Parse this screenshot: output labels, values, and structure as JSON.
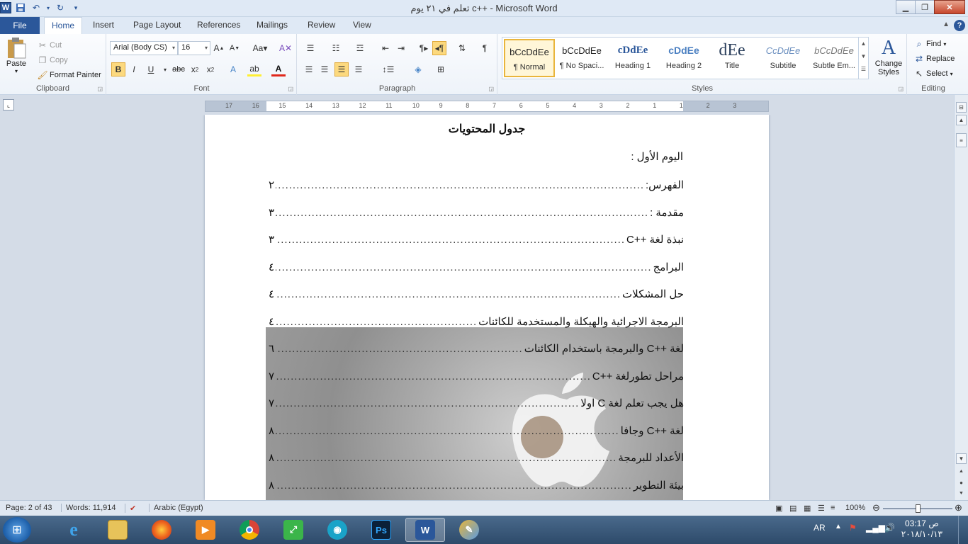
{
  "titlebar": {
    "title": "تعلم في ٢١ يوم  c++ - Microsoft Word"
  },
  "tabs": {
    "file": "File",
    "home": "Home",
    "insert": "Insert",
    "page_layout": "Page Layout",
    "references": "References",
    "mailings": "Mailings",
    "review": "Review",
    "view": "View"
  },
  "ribbon": {
    "clipboard": {
      "paste": "Paste",
      "cut": "Cut",
      "copy": "Copy",
      "format_painter": "Format Painter",
      "label": "Clipboard"
    },
    "font": {
      "name": "Arial (Body CS)",
      "size": "16",
      "label": "Font"
    },
    "paragraph": {
      "label": "Paragraph"
    },
    "styles": {
      "label": "Styles",
      "items": [
        {
          "preview": "bCcDdEe",
          "name": "¶ Normal"
        },
        {
          "preview": "bCcDdEe",
          "name": "¶ No Spaci..."
        },
        {
          "preview": "cDdEe",
          "name": "Heading 1"
        },
        {
          "preview": "cDdEe",
          "name": "Heading 2"
        },
        {
          "preview": "dEe",
          "name": "Title"
        },
        {
          "preview": "CcDdEe",
          "name": "Subtitle"
        },
        {
          "preview": "bCcDdEe",
          "name": "Subtle Em..."
        }
      ],
      "change_styles": "Change Styles"
    },
    "editing": {
      "find": "Find",
      "replace": "Replace",
      "select": "Select",
      "label": "Editing"
    }
  },
  "document": {
    "title": "جدول المحتويات",
    "heading": "اليوم الأول :",
    "entries": [
      {
        "text": "الفهرس:",
        "page": "٢"
      },
      {
        "text": "مقدمة :",
        "page": "٣"
      },
      {
        "text": "نبذة لغة ++C",
        "page": "٣"
      },
      {
        "text": "البرامج",
        "page": "٤"
      },
      {
        "text": "حل المشكلات",
        "page": "٤"
      },
      {
        "text": "البرمجة الاجرائية  والهيكلة والمستخدمة للكائنات",
        "page": "٤"
      },
      {
        "text": "لغة ++C والبرمجة باستخدام الكائنات",
        "page": "٦"
      },
      {
        "text": "مراحل تطورلغة ++C",
        "page": "٧"
      },
      {
        "text": "هل يجب تعلم لغة C اولا",
        "page": "٧"
      },
      {
        "text": "لغة ++C وجافا",
        "page": "٨"
      },
      {
        "text": "الأعداد للبرمجة",
        "page": "٨"
      },
      {
        "text": "بيئة التطوير",
        "page": "٨"
      }
    ]
  },
  "ruler": {
    "ticks": [
      "17",
      "16",
      "15",
      "14",
      "13",
      "12",
      "11",
      "10",
      "9",
      "8",
      "7",
      "6",
      "5",
      "4",
      "3",
      "2",
      "1",
      "1",
      "2",
      "3"
    ]
  },
  "statusbar": {
    "page": "Page: 2 of 43",
    "words": "Words: 11,914",
    "language": "Arabic (Egypt)",
    "zoom": "100%"
  },
  "taskbar": {
    "lang": "AR",
    "time": "03:17 ص",
    "date": "٢٠١٨/١٠/١٣"
  }
}
